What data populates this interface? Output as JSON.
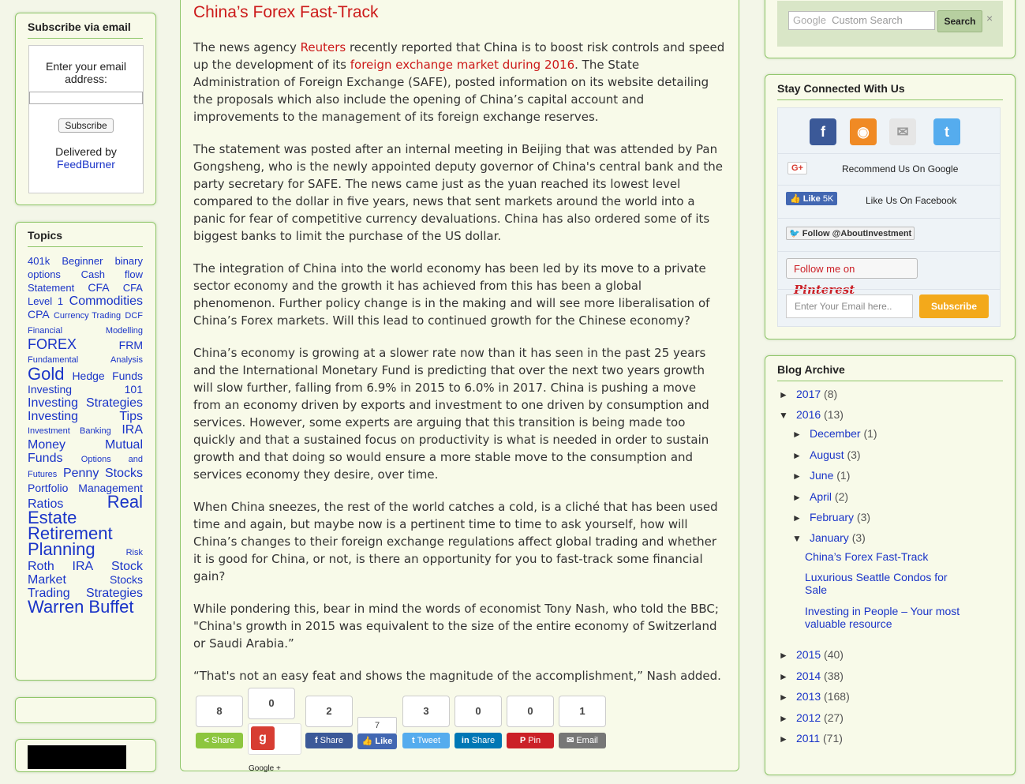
{
  "subscribe": {
    "title": "Subscribe via email",
    "prompt": "Enter your email address:",
    "button": "Subscribe",
    "delivered_by": "Delivered by",
    "feedburner": "FeedBurner"
  },
  "topics": {
    "title": "Topics",
    "tags": [
      {
        "label": "401k",
        "size": 2
      },
      {
        "label": "Beginner",
        "size": 2
      },
      {
        "label": "binary options",
        "size": 2
      },
      {
        "label": "Cash flow Statement",
        "size": 2
      },
      {
        "label": "CFA",
        "size": 3
      },
      {
        "label": "CFA Level 1",
        "size": 2
      },
      {
        "label": "Commodities",
        "size": 4
      },
      {
        "label": "CPA",
        "size": 3
      },
      {
        "label": "Currency Trading",
        "size": 1
      },
      {
        "label": "DCF",
        "size": 1
      },
      {
        "label": "Financial Modelling",
        "size": 1
      },
      {
        "label": "FOREX",
        "size": 5
      },
      {
        "label": "FRM",
        "size": 3
      },
      {
        "label": "Fundamental Analysis",
        "size": 1
      },
      {
        "label": "Gold",
        "size": 6
      },
      {
        "label": "Hedge Funds",
        "size": 3
      },
      {
        "label": "Investing 101",
        "size": 3
      },
      {
        "label": "Investing Strategies",
        "size": 4
      },
      {
        "label": "Investing Tips",
        "size": 4
      },
      {
        "label": "Investment Banking",
        "size": 1
      },
      {
        "label": "IRA",
        "size": 4
      },
      {
        "label": "Money",
        "size": 4
      },
      {
        "label": "Mutual Funds",
        "size": 4
      },
      {
        "label": "Options and Futures",
        "size": 1
      },
      {
        "label": "Penny Stocks",
        "size": 4
      },
      {
        "label": "Portfolio Management",
        "size": 3
      },
      {
        "label": "Ratios",
        "size": 4
      },
      {
        "label": "Real Estate",
        "size": 6
      },
      {
        "label": "Retirement Planning",
        "size": 6
      },
      {
        "label": "Risk",
        "size": 1
      },
      {
        "label": "Roth IRA",
        "size": 4
      },
      {
        "label": "Stock Market",
        "size": 4
      },
      {
        "label": "Stocks",
        "size": 3
      },
      {
        "label": "Trading Strategies",
        "size": 4
      },
      {
        "label": "Warren Buffet",
        "size": 6
      }
    ]
  },
  "post": {
    "title": "China’s Forex Fast-Track",
    "p1": {
      "a": "The news agency ",
      "reuters": "Reuters",
      "b": " recently reported that China is to boost risk controls and speed up the development of its ",
      "fx_link": "foreign exchange market during 2016",
      "c": ". The State Administration of Foreign Exchange (SAFE), posted information on its website detailing the proposals which also include the opening of China’s capital account and improvements to the management of its foreign exchange reserves."
    },
    "p2": "The statement was posted after an internal meeting in Beijing that was attended by Pan Gongsheng, who is the newly appointed deputy governor of China's central bank and the party secretary for SAFE. The news came just as the yuan reached its lowest level compared to the dollar in five years, news that sent markets around the world into a panic for fear of competitive currency devaluations. China has also ordered some of its biggest banks to limit the purchase of the US dollar.",
    "p3": "The integration of China into the world economy has been led by its move to a private sector economy and the growth it has achieved from this has been a global phenomenon. Further policy change is in the making and will see more liberalisation of China’s Forex markets. Will this lead to continued growth for the Chinese economy?",
    "p4": "China’s economy is growing at a slower rate now than it has seen in the past 25 years and the International Monetary Fund is predicting that over the next two years growth will slow further, falling from 6.9% in 2015 to 6.0% in 2017. China is pushing a move from an economy driven by exports and investment to one driven by consumption and services. However, some experts are arguing that this transition is being made too quickly and that a sustained focus on productivity is what is needed in order to sustain growth and that doing so would ensure a more stable move to the consumption and services economy they desire, over time.",
    "p5": "When China sneezes, the rest of the world catches a cold, is a cliché that has been used time and again, but maybe now is a pertinent time to time to ask yourself, how will China’s changes to their foreign exchange regulations affect global trading and whether it is good for China, or not, is there an opportunity for you to fast-track some financial gain?",
    "p6": "While pondering this, bear in mind the words of economist Tony Nash, who told the BBC; \"China's growth in 2015 was equivalent to the size of the entire economy of Switzerland or Saudi Arabia.”",
    "p7": "“That's not an easy feat and shows the magnitude of the accomplishment,”  Nash added."
  },
  "share": {
    "share_count": "8",
    "share_label": "Share",
    "gplus_count": "0",
    "gplus_label": "Google +",
    "fb_count": "2",
    "fb_label": "Share",
    "like_count": "7",
    "like_label": "Like",
    "tweet_count": "3",
    "tweet_label": "Tweet",
    "in_count": "0",
    "in_label": "Share",
    "pin_count": "0",
    "pin_label": "Pin",
    "email_count": "1",
    "email_label": "Email",
    "colors": {
      "share": "#8dc63f",
      "fb": "#3b5998",
      "tweet": "#55acee",
      "in": "#0077b5",
      "pin": "#cb2027",
      "email": "#777777"
    }
  },
  "search": {
    "google": "Google",
    "placeholder": "Custom Search",
    "button": "Search",
    "close": "×"
  },
  "stay": {
    "title": "Stay Connected With Us",
    "gplus_badge": "G+",
    "recommend_google": "Recommend Us On Google",
    "fb_like": "Like",
    "fb_count": "5K",
    "like_facebook": "Like Us On Facebook",
    "twitter_follow": "Follow @AboutInvestment",
    "pinterest_follow": "Follow me on",
    "pinterest_word": "Pinterest",
    "email_placeholder": "Enter Your Email here..",
    "subscribe": "Subscribe"
  },
  "archive": {
    "title": "Blog Archive",
    "y2017": {
      "label": "2017",
      "count": "(8)"
    },
    "y2016": {
      "label": "2016",
      "count": "(13)"
    },
    "december": {
      "label": "December",
      "count": "(1)"
    },
    "august": {
      "label": "August",
      "count": "(3)"
    },
    "june": {
      "label": "June",
      "count": "(1)"
    },
    "april": {
      "label": "April",
      "count": "(2)"
    },
    "february": {
      "label": "February",
      "count": "(3)"
    },
    "january": {
      "label": "January",
      "count": "(3)"
    },
    "posts": [
      "China’s Forex Fast-Track",
      "Luxurious Seattle Condos for Sale",
      "Investing in People – Your most valuable resource"
    ],
    "y2015": {
      "label": "2015",
      "count": "(40)"
    },
    "y2014": {
      "label": "2014",
      "count": "(38)"
    },
    "y2013": {
      "label": "2013",
      "count": "(168)"
    },
    "y2012": {
      "label": "2012",
      "count": "(27)"
    },
    "y2011": {
      "label": "2011",
      "count": "(71)"
    },
    "collapsed": "►",
    "expanded": "▼"
  }
}
